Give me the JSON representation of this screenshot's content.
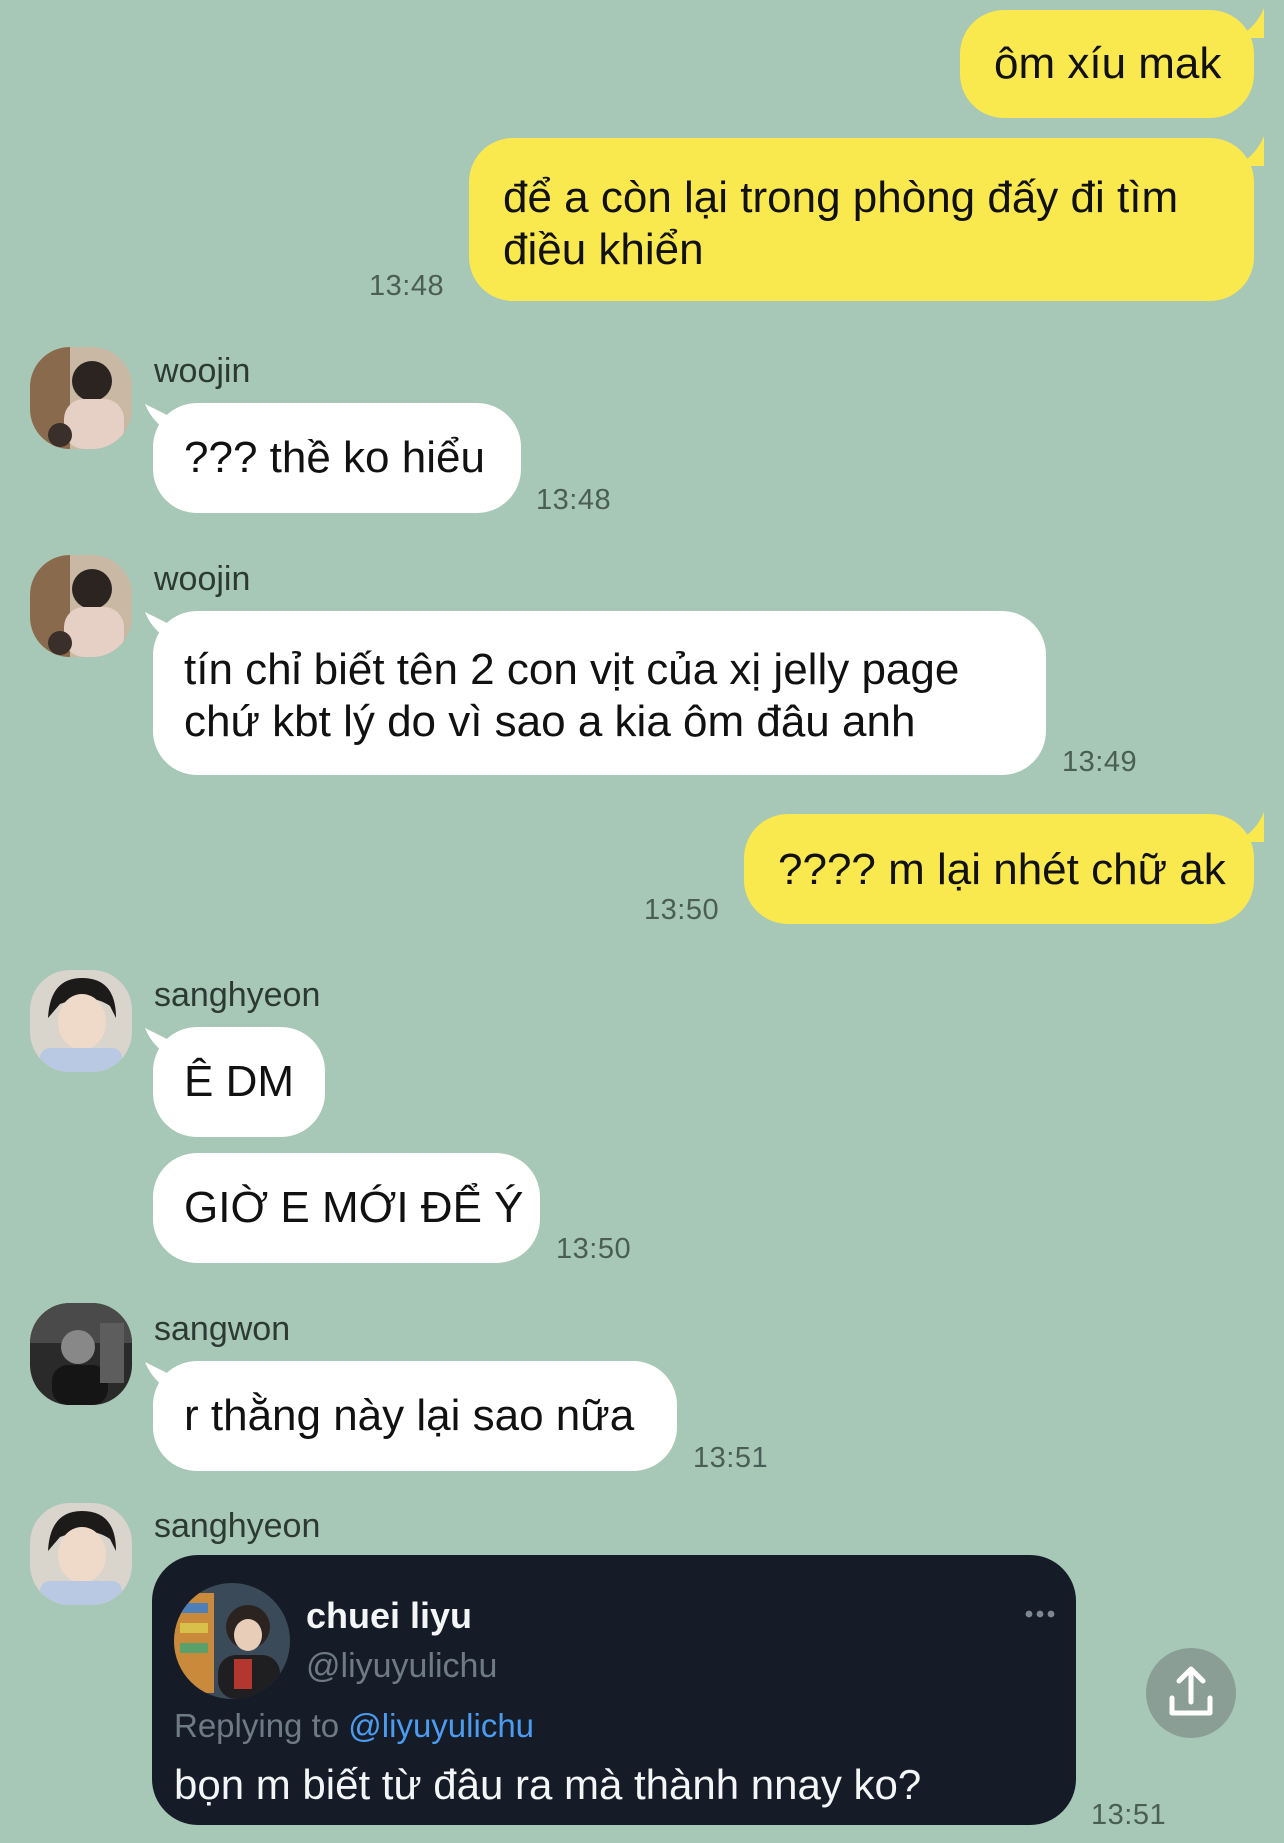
{
  "colors": {
    "background": "#a7c7b7",
    "my_bubble": "#fae84f",
    "their_bubble": "#ffffff",
    "tweet_card": "#161c27",
    "tweet_link": "#4b9cf0"
  },
  "messages": [
    {
      "from": "me",
      "text": "ôm xíu mak"
    },
    {
      "from": "me",
      "text": "để a còn lại trong phòng đấy đi tìm điều khiển",
      "time": "13:48"
    },
    {
      "from": "woojin",
      "sender": "woojin",
      "text": "??? thề ko hiểu",
      "time": "13:48"
    },
    {
      "from": "woojin",
      "sender": "woojin",
      "text": "tín chỉ biết tên 2 con vịt của xị jelly page chứ kbt lý do vì sao a kia ôm đâu anh",
      "time": "13:49"
    },
    {
      "from": "me",
      "text": "???? m lại nhét chữ ak",
      "time": "13:50"
    },
    {
      "from": "sanghyeon",
      "sender": "sanghyeon",
      "text": "Ê DM"
    },
    {
      "from": "sanghyeon",
      "text": "GIỜ E MỚI ĐỂ Ý",
      "time": "13:50"
    },
    {
      "from": "sangwon",
      "sender": "sangwon",
      "text": "r thằng này lại sao nữa",
      "time": "13:51"
    }
  ],
  "shared_post": {
    "sender": "sanghyeon",
    "display_name": "chuei liyu",
    "handle": "@liyuyulichu",
    "replying_prefix": "Replying to",
    "replying_handle": "@liyuyulichu",
    "text": "bọn m biết từ đâu ra mà thành nnay ko?",
    "more_icon": "ellipsis-icon",
    "time": "13:51"
  },
  "share_button": {
    "icon": "share-upload-icon"
  }
}
